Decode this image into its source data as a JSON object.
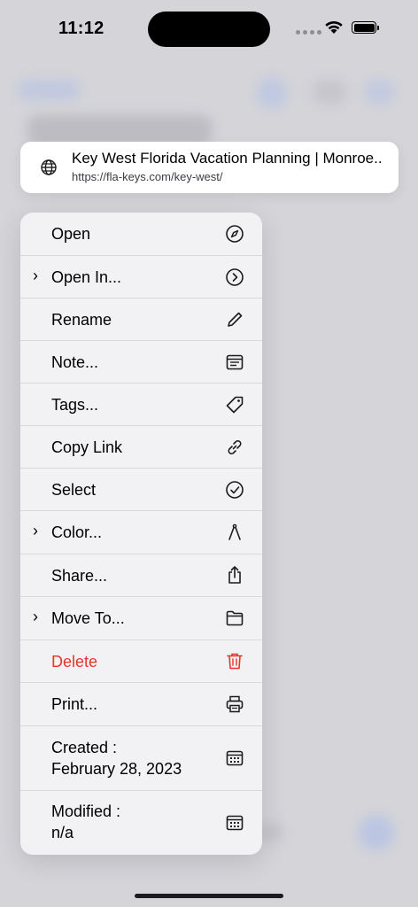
{
  "status_bar": {
    "time": "11:12"
  },
  "link_preview": {
    "title": "Key West Florida Vacation Planning | Monroe...",
    "url": "https://fla-keys.com/key-west/"
  },
  "menu": {
    "items": [
      {
        "label": "Open",
        "icon": "compass-icon",
        "submenu": false
      },
      {
        "label": "Open In...",
        "icon": "chevron-circle-icon",
        "submenu": true
      },
      {
        "label": "Rename",
        "icon": "pencil-icon",
        "submenu": false
      },
      {
        "label": "Note...",
        "icon": "note-icon",
        "submenu": false
      },
      {
        "label": "Tags...",
        "icon": "tag-icon",
        "submenu": false
      },
      {
        "label": "Copy Link",
        "icon": "link-icon",
        "submenu": false
      },
      {
        "label": "Select",
        "icon": "checkmark-circle-icon",
        "submenu": false
      },
      {
        "label": "Color...",
        "icon": "compass-drawing-icon",
        "submenu": true
      },
      {
        "label": "Share...",
        "icon": "share-icon",
        "submenu": false
      },
      {
        "label": "Move To...",
        "icon": "folder-icon",
        "submenu": true
      },
      {
        "label": "Delete",
        "icon": "trash-icon",
        "submenu": false,
        "color": "#e8352b"
      },
      {
        "label": "Print...",
        "icon": "printer-icon",
        "submenu": false
      },
      {
        "label_line1": "Created :",
        "label_line2": "February 28, 2023",
        "icon": "calendar-icon"
      },
      {
        "label_line1": "Modified :",
        "label_line2": "n/a",
        "icon": "calendar-icon"
      }
    ]
  }
}
